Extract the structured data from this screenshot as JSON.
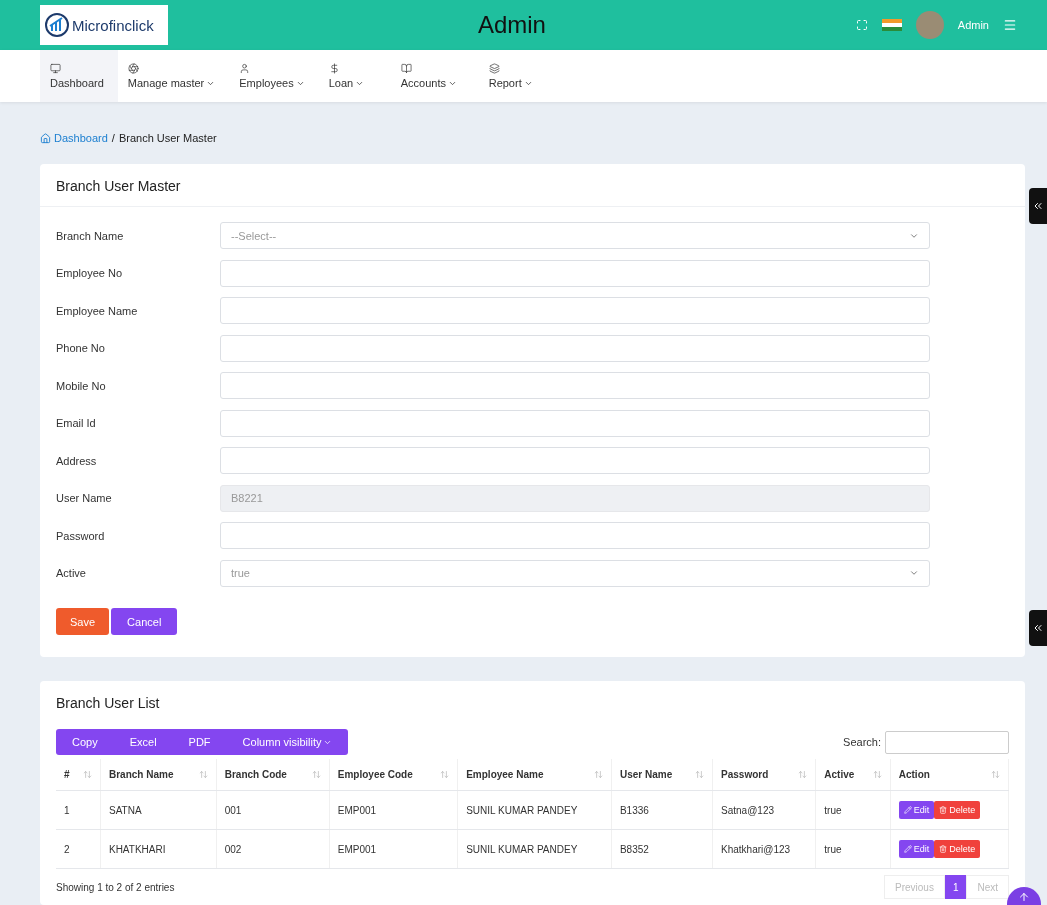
{
  "header": {
    "logo_text": "Microfinclick",
    "title": "Admin",
    "user": "Admin"
  },
  "nav": [
    {
      "label": "Dashboard",
      "dropdown": false,
      "selected": true
    },
    {
      "label": "Manage master",
      "dropdown": true,
      "selected": false
    },
    {
      "label": "Employees",
      "dropdown": true,
      "selected": false
    },
    {
      "label": "Loan",
      "dropdown": true,
      "selected": false
    },
    {
      "label": "Accounts",
      "dropdown": true,
      "selected": false
    },
    {
      "label": "Report",
      "dropdown": true,
      "selected": false
    }
  ],
  "breadcrumb": {
    "separator": "/",
    "items": [
      {
        "label": "Dashboard",
        "link": true
      },
      {
        "label": "Branch User Master",
        "link": false
      }
    ]
  },
  "form": {
    "title": "Branch User Master",
    "fields": [
      {
        "label": "Branch Name",
        "kind": "select",
        "placeholder": "--Select--",
        "disabled": false
      },
      {
        "label": "Employee No",
        "kind": "input",
        "disabled": false
      },
      {
        "label": "Employee Name",
        "kind": "input",
        "disabled": false
      },
      {
        "label": "Phone No",
        "kind": "input",
        "disabled": false
      },
      {
        "label": "Mobile No",
        "kind": "input",
        "disabled": false
      },
      {
        "label": "Email Id",
        "kind": "input",
        "disabled": false
      },
      {
        "label": "Address",
        "kind": "input",
        "disabled": false
      },
      {
        "label": "User Name",
        "kind": "input",
        "value": "B8221",
        "disabled": true
      },
      {
        "label": "Password",
        "kind": "input",
        "disabled": false
      },
      {
        "label": "Active",
        "kind": "select",
        "value": "true",
        "disabled": false
      }
    ],
    "buttons": [
      {
        "label": "Save",
        "kind": "primary"
      },
      {
        "label": "Cancel",
        "kind": "secondary"
      }
    ]
  },
  "list": {
    "title": "Branch User List",
    "export_buttons": [
      "Copy",
      "Excel",
      "PDF",
      "Column visibility"
    ],
    "search_label": "Search:",
    "columns": [
      "#",
      "Branch Name",
      "Branch Code",
      "Employee Code",
      "Employee Name",
      "User Name",
      "Password",
      "Active",
      "Action"
    ],
    "rows": [
      {
        "cells": [
          "1",
          "SATNA",
          "001",
          "EMP001",
          "SUNIL KUMAR PANDEY",
          "B1336",
          "Satna@123",
          "true"
        ],
        "actions": [
          "Edit",
          "Delete"
        ]
      },
      {
        "cells": [
          "2",
          "KHATKHARI",
          "002",
          "EMP001",
          "SUNIL KUMAR PANDEY",
          "B8352",
          "Khatkhari@123",
          "true"
        ],
        "actions": [
          "Edit",
          "Delete"
        ]
      }
    ],
    "info": "Showing 1 to 2 of 2 entries",
    "pagination": [
      {
        "label": "Previous",
        "selected": false,
        "disabled": true
      },
      {
        "label": "1",
        "selected": true,
        "disabled": false
      },
      {
        "label": "Next",
        "selected": false,
        "disabled": true
      }
    ]
  }
}
